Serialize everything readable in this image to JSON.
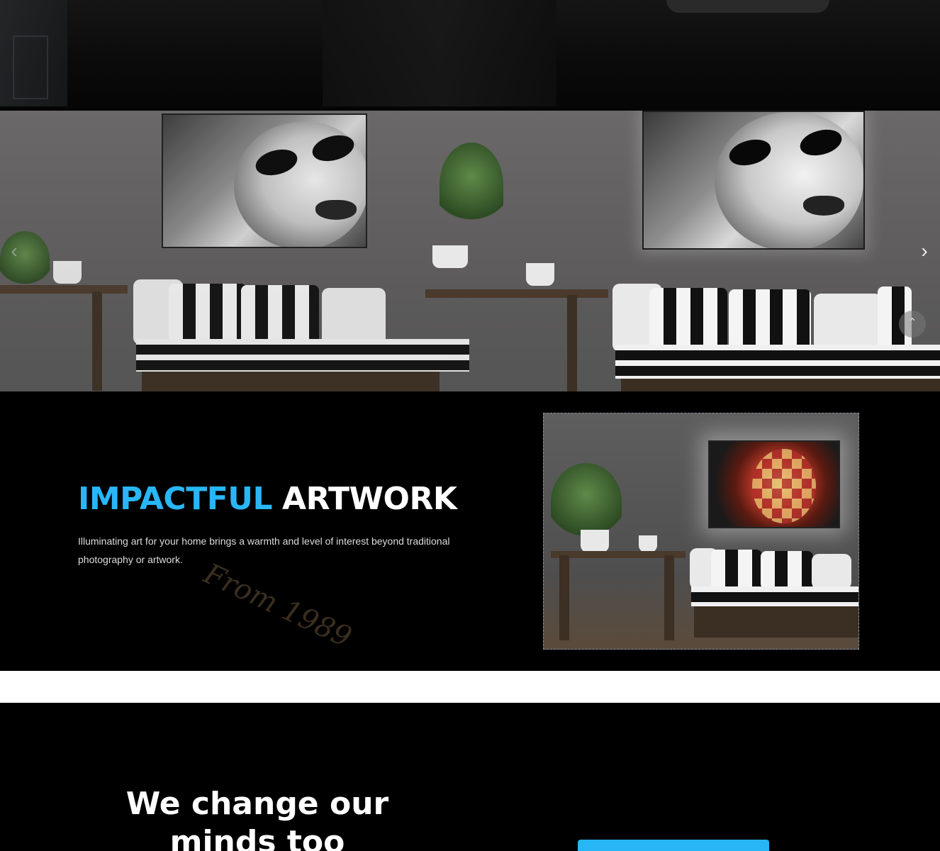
{
  "slider": {
    "next_icon": "›",
    "prev_icon": "‹",
    "scroll_top_icon": "⌃"
  },
  "impact": {
    "title_blue": "IMPACTFUL",
    "title_white": "ARTWORK",
    "description": "Illuminating art for your home brings a warmth and level of interest beyond traditional photography or artwork.",
    "watermark": "From 1989"
  },
  "bottom": {
    "heading": "We change our minds too"
  },
  "colors": {
    "accent": "#29b6f6",
    "background": "#000000",
    "band": "#ffffff"
  }
}
